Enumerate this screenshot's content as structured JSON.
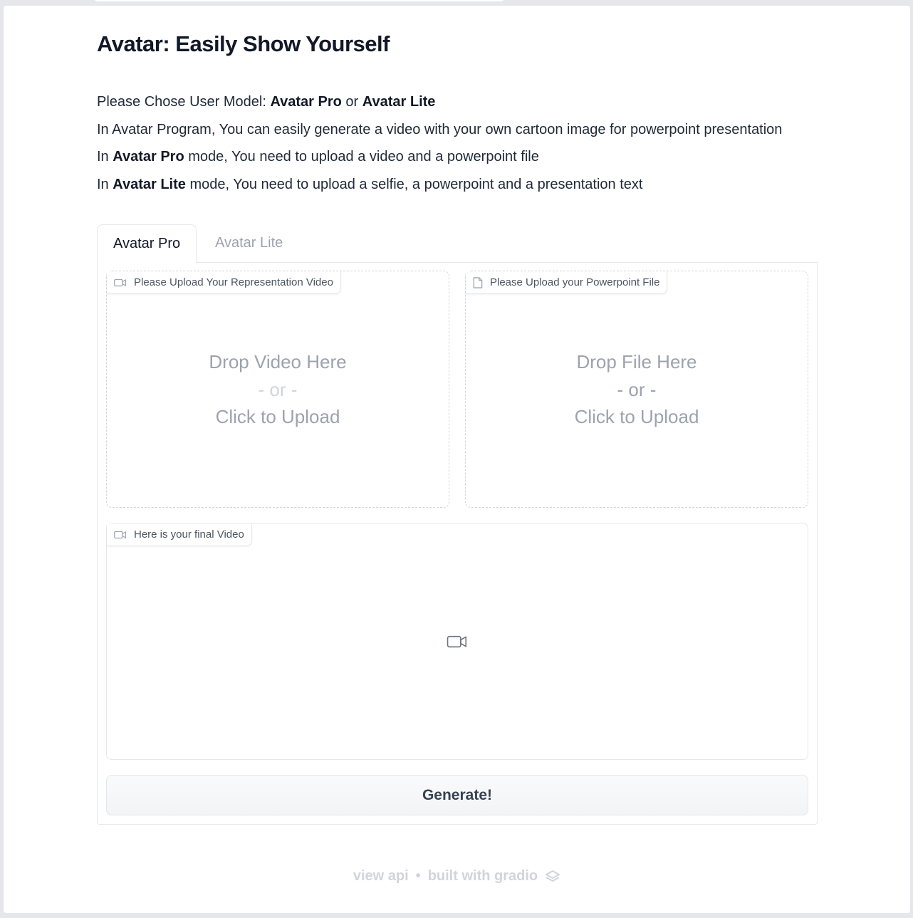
{
  "app": {
    "title": "Avatar: Easily Show Yourself"
  },
  "description": {
    "line1_prefix": "Please Chose User Model: ",
    "line1_pro": "Avatar Pro",
    "line1_or": " or ",
    "line1_lite": "Avatar Lite",
    "line2": "In Avatar Program, You can easily generate a video with your own cartoon image for powerpoint presentation",
    "line3_prefix": "In ",
    "line3_pro": "Avatar Pro",
    "line3_suffix": " mode, You need to upload a video and a powerpoint file",
    "line4_prefix": "In ",
    "line4_lite": "Avatar Lite",
    "line4_suffix": " mode, You need to upload a selfie, a powerpoint and a presentation text"
  },
  "tabs": [
    {
      "label": "Avatar Pro",
      "selected": true
    },
    {
      "label": "Avatar Lite",
      "selected": false
    }
  ],
  "video_upload": {
    "label": "Please Upload Your Representation Video",
    "drop_text": "Drop Video Here",
    "or_text": "- or -",
    "click_text": "Click to Upload"
  },
  "file_upload": {
    "label": "Please Upload your Powerpoint File",
    "drop_text": "Drop File Here",
    "or_text": "- or -",
    "click_text": "Click to Upload"
  },
  "output_video": {
    "label": "Here is your final Video"
  },
  "generate_button": {
    "label": "Generate!"
  },
  "footer": {
    "view_api": "view api",
    "separator": "•",
    "built_with": "built with gradio"
  },
  "icons": {
    "video": "video-camera-icon",
    "file": "file-icon",
    "gradio": "gradio-logo-icon"
  }
}
